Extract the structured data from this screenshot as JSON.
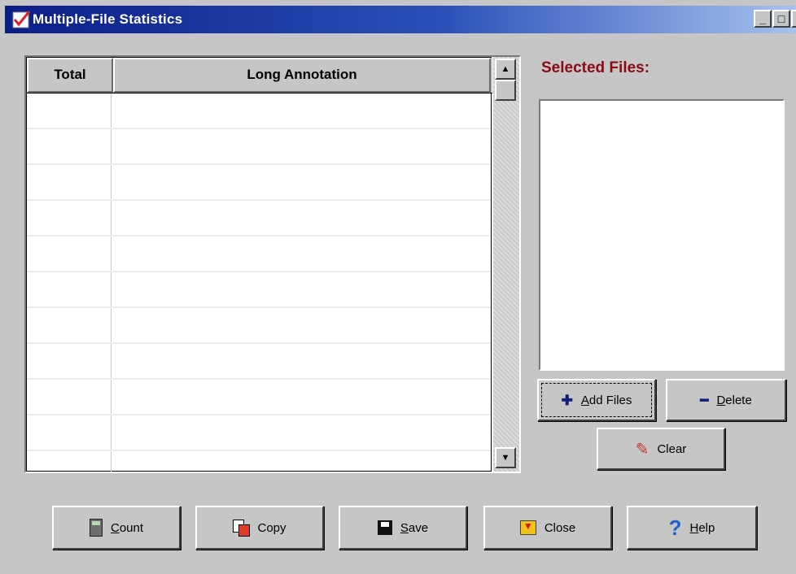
{
  "window": {
    "title": "Multiple-File Statistics",
    "minimize": "_",
    "maximize": "□",
    "close": "×"
  },
  "grid": {
    "columns": [
      "Total",
      "Long Annotation"
    ],
    "rows": [
      [
        "",
        ""
      ],
      [
        "",
        ""
      ],
      [
        "",
        ""
      ],
      [
        "",
        ""
      ],
      [
        "",
        ""
      ],
      [
        "",
        ""
      ],
      [
        "",
        ""
      ],
      [
        "",
        ""
      ],
      [
        "",
        ""
      ],
      [
        "",
        ""
      ],
      [
        "",
        ""
      ]
    ],
    "scroll_up": "▲",
    "scroll_down": "▼"
  },
  "selected_files": {
    "label": "Selected Files:",
    "items": []
  },
  "buttons": {
    "add_files": "Add Files",
    "delete": "Delete",
    "clear": "Clear",
    "count": "Count",
    "copy": "Copy",
    "save": "Save",
    "close": "Close",
    "help": "Help"
  },
  "icons": {
    "app": "checkmark-icon",
    "add": "plus-icon",
    "delete": "minus-icon",
    "clear": "eraser-icon",
    "count": "calculator-icon",
    "copy": "copy-icon",
    "save": "floppy-disk-icon",
    "close": "close-door-icon",
    "help": "question-mark-icon"
  },
  "colors": {
    "title_bar_start": "#0a1e86",
    "title_bar_end": "#a6c2ee",
    "selected_files_label": "#8b0a14",
    "window_background": "#c6c6c6"
  }
}
